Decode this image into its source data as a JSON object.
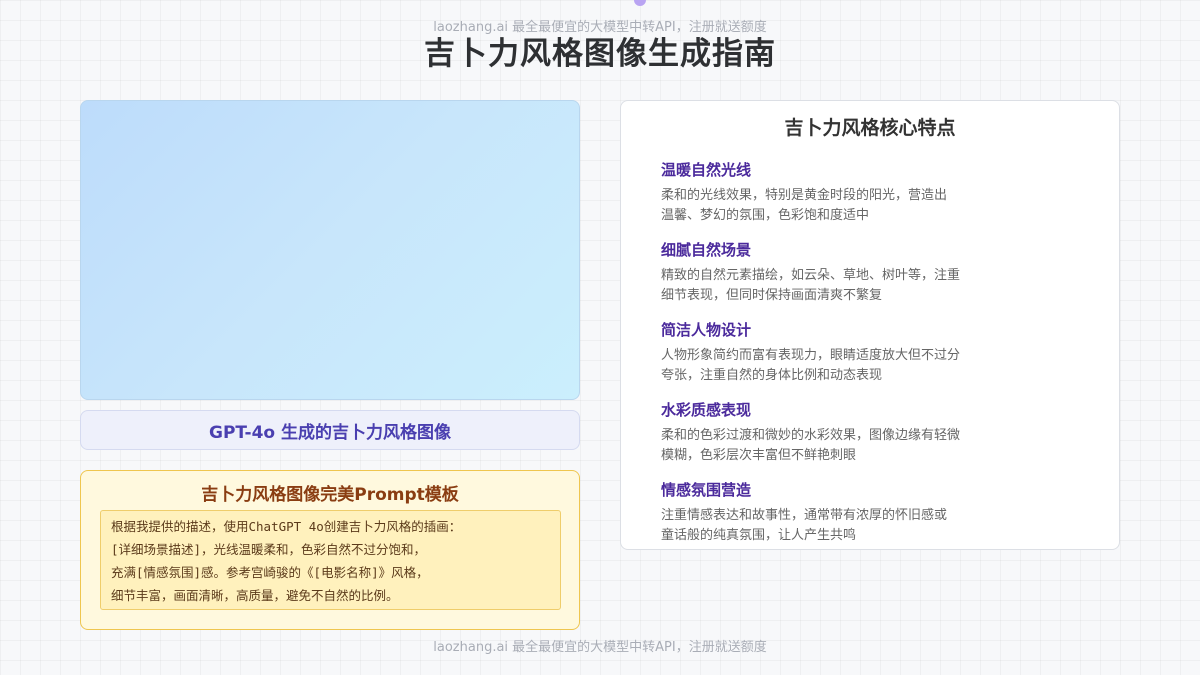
{
  "watermark": {
    "top": "laozhang.ai 最全最便宜的大模型中转API，注册就送额度",
    "bottom": "laozhang.ai 最全最便宜的大模型中转API，注册就送额度"
  },
  "page_title": "吉卜力风格图像生成指南",
  "image_caption": "GPT-4o 生成的吉卜力风格图像",
  "prompt_template": {
    "title": "吉卜力风格图像完美Prompt模板",
    "lines": [
      "根据我提供的描述，使用ChatGPT 4o创建吉卜力风格的插画：",
      "[详细场景描述]，光线温暖柔和，色彩自然不过分饱和，",
      "充满[情感氛围]感。参考宫崎骏的《[电影名称]》风格，",
      "细节丰富，画面清晰，高质量，避免不自然的比例。"
    ]
  },
  "features": {
    "title": "吉卜力风格核心特点",
    "items": [
      {
        "heading": "温暖自然光线",
        "desc_lines": [
          "柔和的光线效果，特别是黄金时段的阳光，营造出",
          "温馨、梦幻的氛围，色彩饱和度适中"
        ]
      },
      {
        "heading": "细腻自然场景",
        "desc_lines": [
          "精致的自然元素描绘，如云朵、草地、树叶等，注重",
          "细节表现，但同时保持画面清爽不繁复"
        ]
      },
      {
        "heading": "简洁人物设计",
        "desc_lines": [
          "人物形象简约而富有表现力，眼睛适度放大但不过分",
          "夸张，注重自然的身体比例和动态表现"
        ]
      },
      {
        "heading": "水彩质感表现",
        "desc_lines": [
          "柔和的色彩过渡和微妙的水彩效果，图像边缘有轻微",
          "模糊，色彩层次丰富但不鲜艳刺眼"
        ]
      },
      {
        "heading": "情感氛围营造",
        "desc_lines": [
          "注重情感表达和故事性，通常带有浓厚的怀旧感或",
          "童话般的纯真氛围，让人产生共鸣"
        ]
      }
    ]
  },
  "colors": {
    "accent_purple": "#4b2a9c",
    "caption_blue": "#4a3fb0",
    "prompt_brown": "#8a3d12",
    "prompt_border": "#efc64f"
  }
}
